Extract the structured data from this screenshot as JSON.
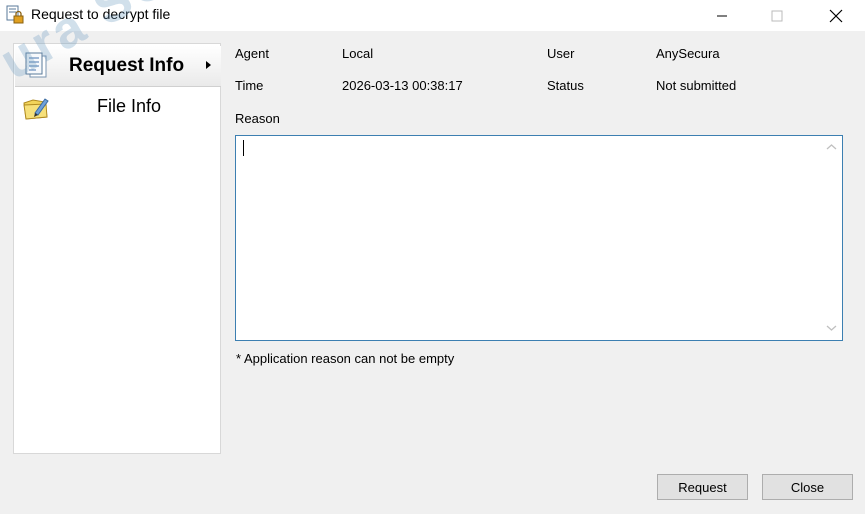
{
  "window": {
    "title": "Request to decrypt file",
    "icon": "lock-document-icon"
  },
  "watermark": {
    "text": "ura SOFTW"
  },
  "sidebar": {
    "items": [
      {
        "label": "Request Info",
        "icon": "document-list-icon",
        "active": true
      },
      {
        "label": "File Info",
        "icon": "folder-pencil-icon",
        "active": false
      }
    ]
  },
  "details": {
    "agent_label": "Agent",
    "agent_value": "Local",
    "user_label": "User",
    "user_value": "AnySecura",
    "time_label": "Time",
    "time_value": "2026-03-13 00:38:17",
    "status_label": "Status",
    "status_value": "Not submitted",
    "reason_label": "Reason",
    "reason_value": ""
  },
  "hint": "* Application reason can not be empty",
  "buttons": {
    "request": "Request",
    "close": "Close"
  },
  "colors": {
    "accent_border": "#3c7fb1",
    "watermark": "#6a9ac0"
  }
}
